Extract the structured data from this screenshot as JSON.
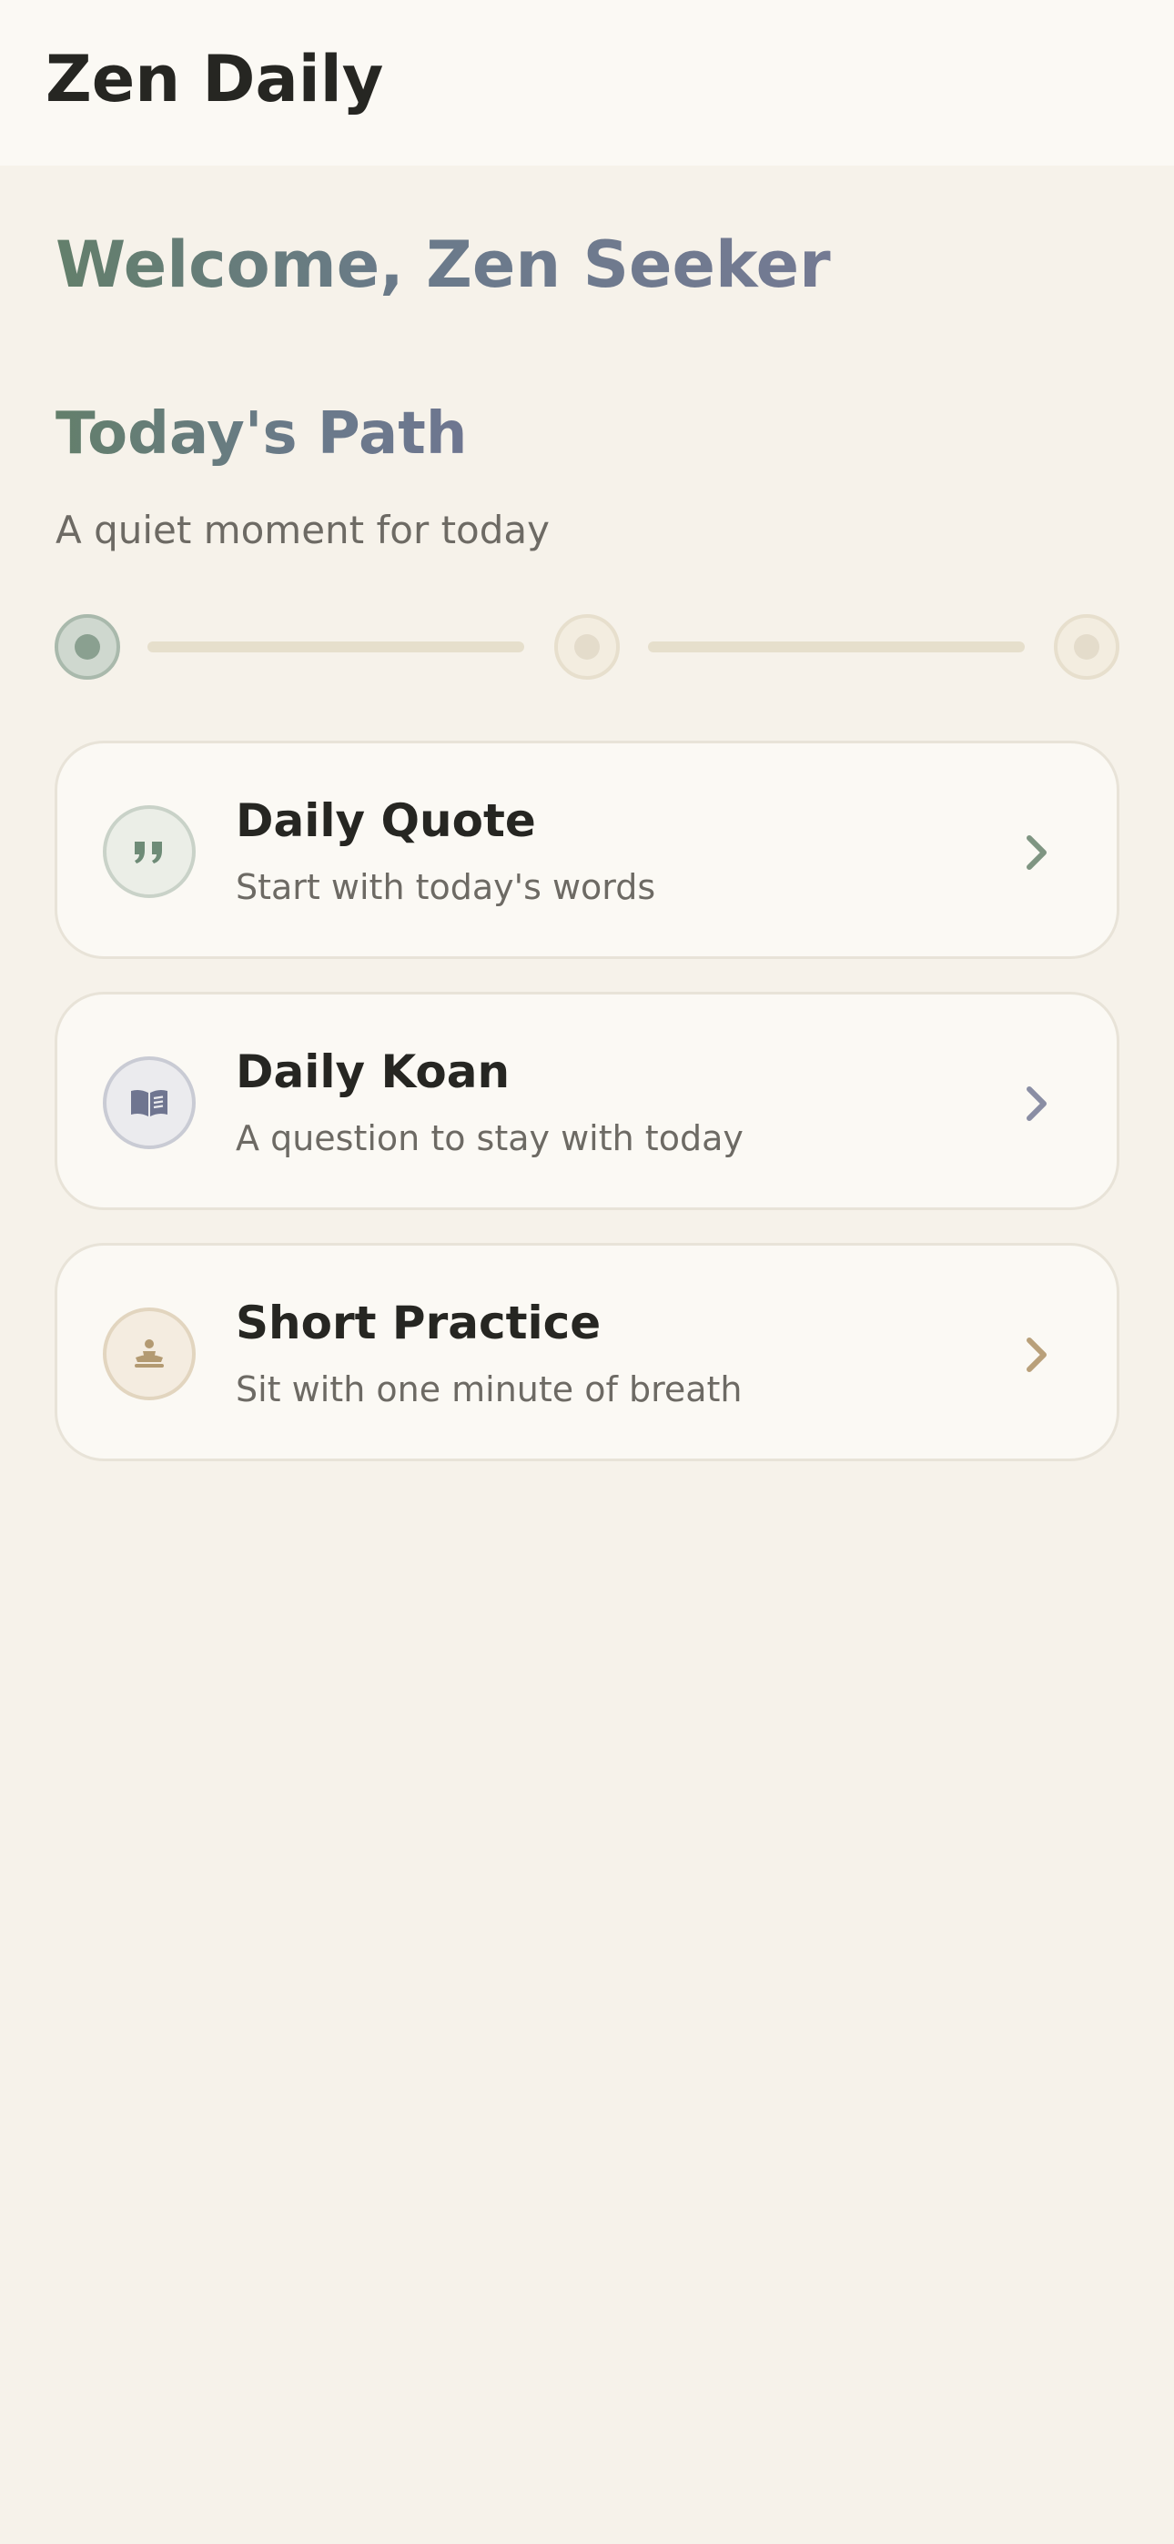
{
  "app": {
    "title": "Zen Daily"
  },
  "welcome": {
    "text": "Welcome, Zen Seeker"
  },
  "path_section": {
    "title": "Today's Path",
    "subtitle": "A quiet moment for today",
    "steps_total": 3,
    "current_step": 1
  },
  "cards": [
    {
      "title": "Daily Quote",
      "description": "Start with today's words",
      "icon": "quote-icon",
      "accent": "#6e8b77"
    },
    {
      "title": "Daily Koan",
      "description": "A question to stay with today",
      "icon": "book-icon",
      "accent": "#747a93"
    },
    {
      "title": "Short Practice",
      "description": "Sit with one minute of breath",
      "icon": "meditation-icon",
      "accent": "#b39a72"
    }
  ],
  "colors": {
    "background": "#f6f2ea",
    "header_background": "#fbf9f4",
    "card_background": "#fbf9f4",
    "sage": "#637f6b",
    "slate": "#747a93",
    "sand": "#b39a72"
  }
}
